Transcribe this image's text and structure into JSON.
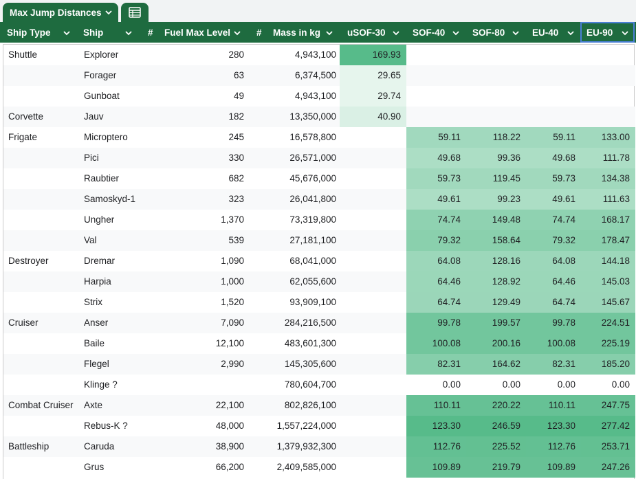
{
  "table": {
    "name": "Max Jump Distances",
    "columns": [
      "Ship Type",
      "Ship",
      "#",
      "Fuel Max Level",
      "#",
      "Mass in kg",
      "uSOF-30",
      "SOF-40",
      "SOF-80",
      "EU-40",
      "EU-90"
    ],
    "selected_column": "EU-90"
  },
  "colors": {
    "header_bg": "#1e6b3f",
    "row_stripe": "#f8f9fa",
    "selection_border": "#4a7fd6",
    "heat_low": "#ffffff",
    "heat_high": "#57bb8a"
  },
  "rows": [
    {
      "type": "Shuttle",
      "ship": "Explorer",
      "fuel": "280",
      "mass": "4,943,100",
      "usof30": "169.93",
      "sof40": "",
      "sof80": "",
      "eu40": "",
      "eu90": ""
    },
    {
      "type": "",
      "ship": "Forager",
      "fuel": "63",
      "mass": "6,374,500",
      "usof30": "29.65",
      "sof40": "",
      "sof80": "",
      "eu40": "",
      "eu90": ""
    },
    {
      "type": "",
      "ship": "Gunboat",
      "fuel": "49",
      "mass": "4,943,100",
      "usof30": "29.74",
      "sof40": "",
      "sof80": "",
      "eu40": "",
      "eu90": ""
    },
    {
      "type": "Corvette",
      "ship": "Jauv",
      "fuel": "182",
      "mass": "13,350,000",
      "usof30": "40.90",
      "sof40": "",
      "sof80": "",
      "eu40": "",
      "eu90": ""
    },
    {
      "type": "Frigate",
      "ship": "Microptero",
      "fuel": "245",
      "mass": "16,578,800",
      "usof30": "",
      "sof40": "59.11",
      "sof80": "118.22",
      "eu40": "59.11",
      "eu90": "133.00"
    },
    {
      "type": "",
      "ship": "Pici",
      "fuel": "330",
      "mass": "26,571,000",
      "usof30": "",
      "sof40": "49.68",
      "sof80": "99.36",
      "eu40": "49.68",
      "eu90": "111.78"
    },
    {
      "type": "",
      "ship": "Raubtier",
      "fuel": "682",
      "mass": "45,676,000",
      "usof30": "",
      "sof40": "59.73",
      "sof80": "119.45",
      "eu40": "59.73",
      "eu90": "134.38"
    },
    {
      "type": "",
      "ship": "Samoskyd-1",
      "fuel": "323",
      "mass": "26,041,800",
      "usof30": "",
      "sof40": "49.61",
      "sof80": "99.23",
      "eu40": "49.61",
      "eu90": "111.63"
    },
    {
      "type": "",
      "ship": "Ungher",
      "fuel": "1,370",
      "mass": "73,319,800",
      "usof30": "",
      "sof40": "74.74",
      "sof80": "149.48",
      "eu40": "74.74",
      "eu90": "168.17"
    },
    {
      "type": "",
      "ship": "Val",
      "fuel": "539",
      "mass": "27,181,100",
      "usof30": "",
      "sof40": "79.32",
      "sof80": "158.64",
      "eu40": "79.32",
      "eu90": "178.47"
    },
    {
      "type": "Destroyer",
      "ship": "Dremar",
      "fuel": "1,090",
      "mass": "68,041,000",
      "usof30": "",
      "sof40": "64.08",
      "sof80": "128.16",
      "eu40": "64.08",
      "eu90": "144.18"
    },
    {
      "type": "",
      "ship": "Harpia",
      "fuel": "1,000",
      "mass": "62,055,600",
      "usof30": "",
      "sof40": "64.46",
      "sof80": "128.92",
      "eu40": "64.46",
      "eu90": "145.03"
    },
    {
      "type": "",
      "ship": "Strix",
      "fuel": "1,520",
      "mass": "93,909,100",
      "usof30": "",
      "sof40": "64.74",
      "sof80": "129.49",
      "eu40": "64.74",
      "eu90": "145.67"
    },
    {
      "type": "Cruiser",
      "ship": "Anser",
      "fuel": "7,090",
      "mass": "284,216,500",
      "usof30": "",
      "sof40": "99.78",
      "sof80": "199.57",
      "eu40": "99.78",
      "eu90": "224.51"
    },
    {
      "type": "",
      "ship": "Baile",
      "fuel": "12,100",
      "mass": "483,601,300",
      "usof30": "",
      "sof40": "100.08",
      "sof80": "200.16",
      "eu40": "100.08",
      "eu90": "225.19"
    },
    {
      "type": "",
      "ship": "Flegel",
      "fuel": "2,990",
      "mass": "145,305,600",
      "usof30": "",
      "sof40": "82.31",
      "sof80": "164.62",
      "eu40": "82.31",
      "eu90": "185.20"
    },
    {
      "type": "",
      "ship": "Klinge ?",
      "fuel": "",
      "mass": "780,604,700",
      "usof30": "",
      "sof40": "0.00",
      "sof80": "0.00",
      "eu40": "0.00",
      "eu90": "0.00"
    },
    {
      "type": "Combat Cruiser",
      "ship": "Axte",
      "fuel": "22,100",
      "mass": "802,826,100",
      "usof30": "",
      "sof40": "110.11",
      "sof80": "220.22",
      "eu40": "110.11",
      "eu90": "247.75"
    },
    {
      "type": "",
      "ship": "Rebus-K ?",
      "fuel": "48,000",
      "mass": "1,557,224,000",
      "usof30": "",
      "sof40": "123.30",
      "sof80": "246.59",
      "eu40": "123.30",
      "eu90": "277.42"
    },
    {
      "type": "Battleship",
      "ship": "Caruda",
      "fuel": "38,900",
      "mass": "1,379,932,300",
      "usof30": "",
      "sof40": "112.76",
      "sof80": "225.52",
      "eu40": "112.76",
      "eu90": "253.71"
    },
    {
      "type": "",
      "ship": "Grus",
      "fuel": "66,200",
      "mass": "2,409,585,000",
      "usof30": "",
      "sof40": "109.89",
      "sof80": "219.79",
      "eu40": "109.89",
      "eu90": "247.26"
    }
  ]
}
